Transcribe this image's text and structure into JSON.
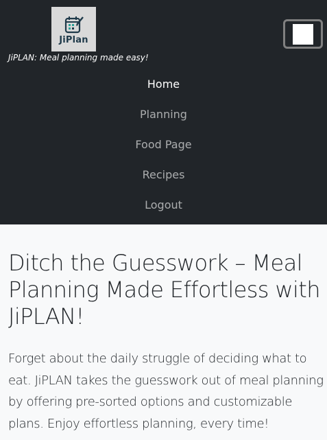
{
  "brand": {
    "logo_text": "JiPlan",
    "tagline": "JiPLAN: Meal planning made easy!",
    "logo_icon": "calendar-checklist-icon"
  },
  "toggler": {
    "icon": "hamburger-menu-icon"
  },
  "nav": {
    "items": [
      {
        "label": "Home",
        "active": true
      },
      {
        "label": "Planning",
        "active": false
      },
      {
        "label": "Food Page",
        "active": false
      },
      {
        "label": "Recipes",
        "active": false
      },
      {
        "label": "Logout",
        "active": false
      }
    ]
  },
  "hero": {
    "title": "Ditch the Guesswork – Meal Planning Made Effortless with JiPLAN!",
    "body": "Forget about the daily struggle of deciding what to eat. JiPLAN takes the guesswork out of meal planning by offering pre-sorted options and customizable plans. Enjoy effortless planning, every time!"
  },
  "colors": {
    "navbar_bg": "#212529",
    "page_bg": "#f8f9fa",
    "logo_bg": "#d9d9d9",
    "text_dark": "#212529"
  }
}
